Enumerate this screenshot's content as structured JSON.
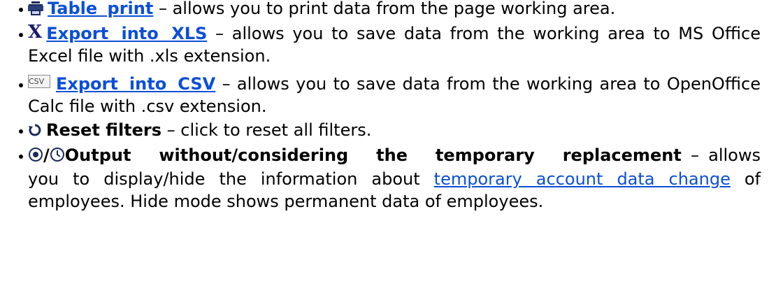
{
  "items": [
    {
      "icon": "printer-icon",
      "link": "Table print",
      "text": " – allows you to print data from the page working area."
    },
    {
      "icon": "excel-x-icon",
      "icon_glyph": "X",
      "link": "Export into XLS",
      "text": " – allows you to save data from the working area to MS Office Excel file with .xls extension."
    },
    {
      "icon": "csv-icon",
      "icon_label": "CSV",
      "link": "Export into CSV",
      "text": " – allows you to save data from the working area to  OpenOffice Calc file with .csv extension."
    },
    {
      "icon": "reset-icon",
      "title": "Reset filters",
      "text": " – click to reset all filters."
    },
    {
      "icons": [
        "output-normal-icon",
        "clock-icon"
      ],
      "slash": "/",
      "title": "Output without/considering the temporary replacement",
      "text_before_link": " – allows you to display/hide the information about ",
      "link": "temporary account data change",
      "text_after_link": " of employees. Hide mode shows permanent data of employees."
    }
  ],
  "colors": {
    "link": "#0b4fd8",
    "text": "#000000"
  }
}
